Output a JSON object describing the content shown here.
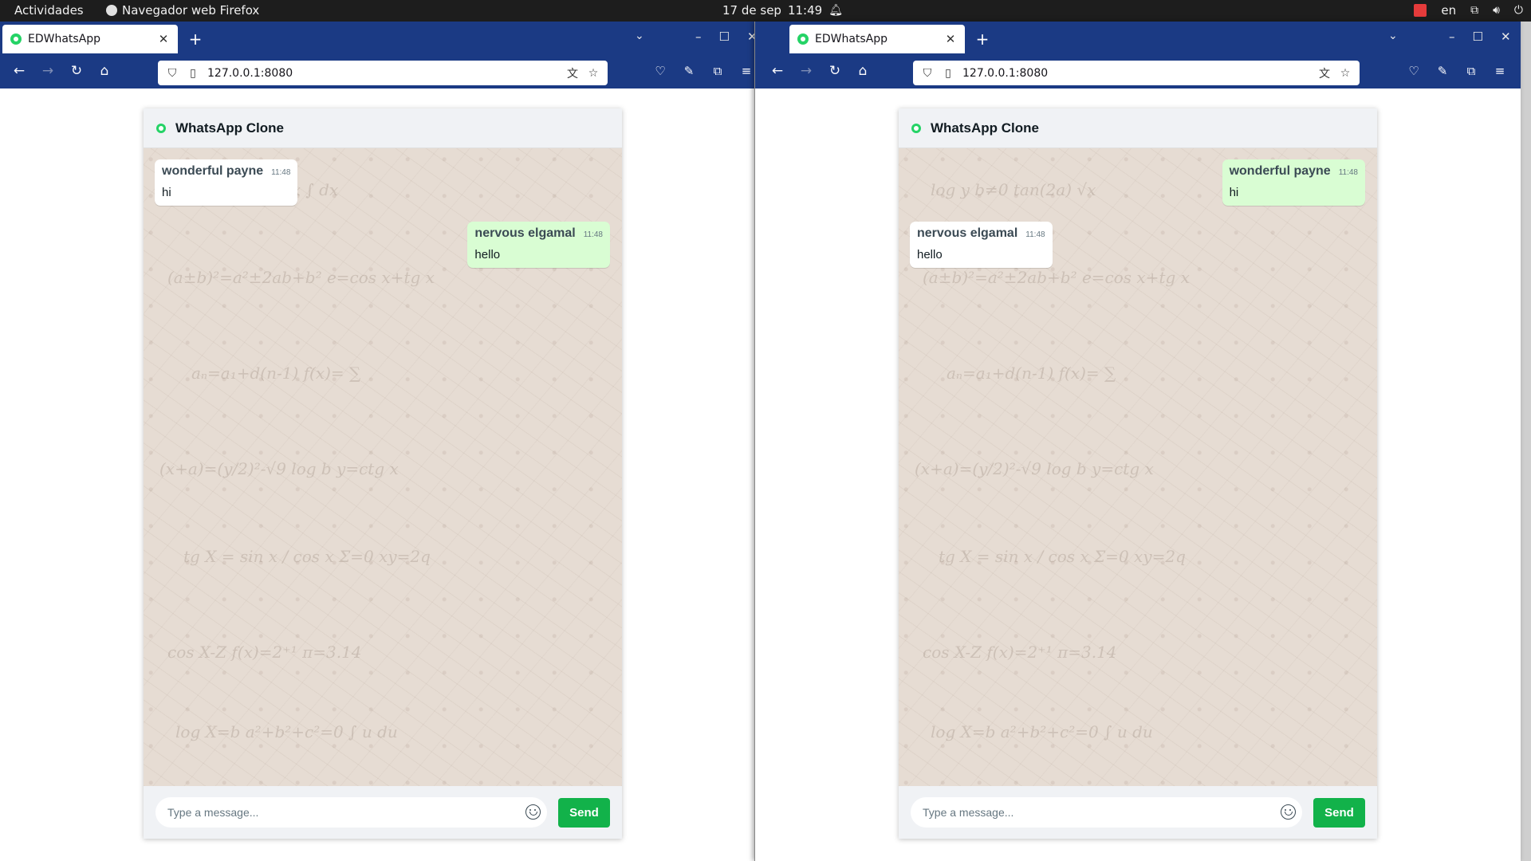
{
  "topbar": {
    "activities": "Actividades",
    "app_name": "Navegador web Firefox",
    "date": "17 de sep",
    "time": "11:49",
    "language": "en"
  },
  "windows": [
    {
      "tab_title": "EDWhatsApp",
      "url": "127.0.0.1:8080",
      "app": {
        "title": "WhatsApp Clone",
        "messages": [
          {
            "sender": "wonderful payne",
            "time": "11:48",
            "text": "hi",
            "side": "in"
          },
          {
            "sender": "nervous elgamal",
            "time": "11:48",
            "text": "hello",
            "side": "out"
          }
        ],
        "input_placeholder": "Type a message...",
        "send_label": "Send"
      }
    },
    {
      "tab_title": "EDWhatsApp",
      "url": "127.0.0.1:8080",
      "app": {
        "title": "WhatsApp Clone",
        "messages": [
          {
            "sender": "wonderful payne",
            "time": "11:48",
            "text": "hi",
            "side": "out"
          },
          {
            "sender": "nervous elgamal",
            "time": "11:48",
            "text": "hello",
            "side": "in"
          }
        ],
        "input_placeholder": "Type a message...",
        "send_label": "Send"
      }
    }
  ],
  "colors": {
    "browser_chrome": "#1b3a84",
    "topbar": "#1d1d1d",
    "outgoing_bubble": "#d9fdd3",
    "incoming_bubble": "#ffffff",
    "send_button": "#12b24a",
    "whatsapp_green": "#25d366",
    "chat_background": "#e6dcd3"
  }
}
